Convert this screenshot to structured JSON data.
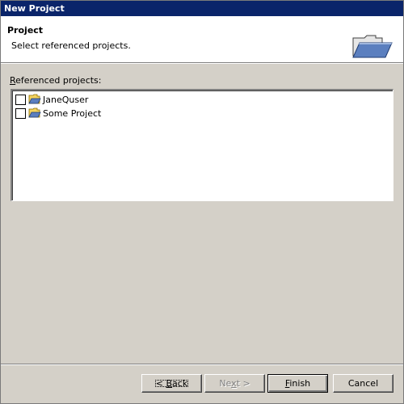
{
  "window": {
    "title": "New Project"
  },
  "banner": {
    "title": "Project",
    "description": "Select referenced projects."
  },
  "references": {
    "label_prefix": "R",
    "label_rest": "eferenced projects:",
    "items": [
      {
        "label": "JaneQuser",
        "checked": false
      },
      {
        "label": "Some Project",
        "checked": false
      }
    ]
  },
  "buttons": {
    "back_prefix": "< ",
    "back_mnemonic": "B",
    "back_rest": "ack",
    "next_prefix": "Ne",
    "next_mnemonic": "x",
    "next_rest": "t >",
    "finish_mnemonic": "F",
    "finish_rest": "inish",
    "cancel": "Cancel"
  },
  "colors": {
    "titlebar": "#0a246a",
    "dialog_bg": "#d4d0c8",
    "folder_yellow": "#f4d35e",
    "folder_blue": "#5b7fbf"
  },
  "icons": {
    "banner": "open-folder-icon",
    "project": "project-folder-icon"
  }
}
